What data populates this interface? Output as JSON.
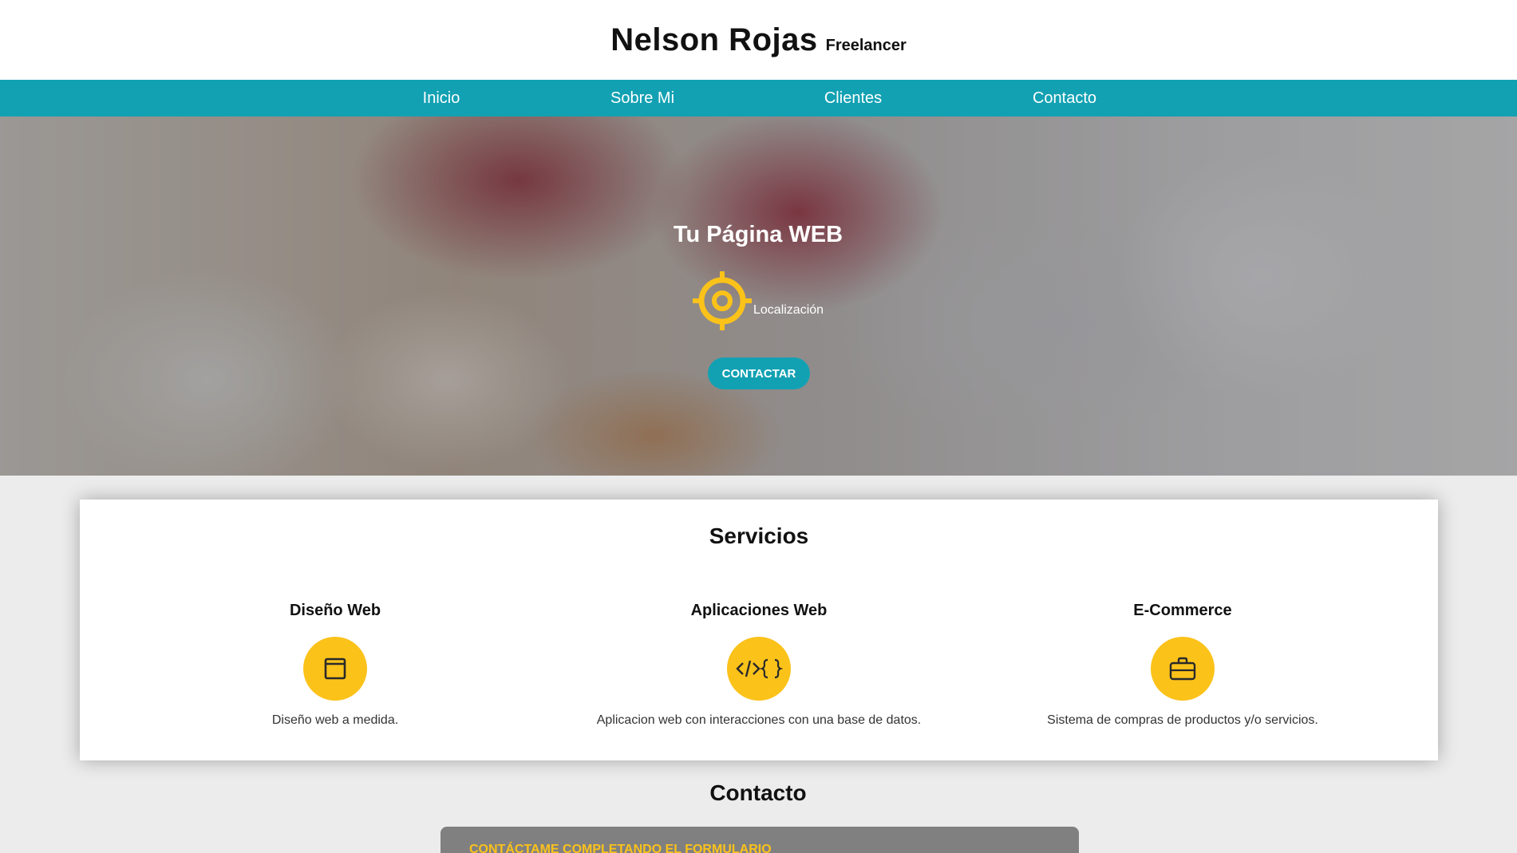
{
  "header": {
    "name": "Nelson Rojas",
    "tagline": "Freelancer"
  },
  "nav": {
    "items": [
      "Inicio",
      "Sobre Mi",
      "Clientes",
      "Contacto"
    ]
  },
  "hero": {
    "title": "Tu Página WEB",
    "location_icon": "target-icon",
    "location_label": "Localización",
    "cta_label": "CONTACTAR"
  },
  "services": {
    "title": "Servicios",
    "items": [
      {
        "title": "Diseño Web",
        "icon": "browser-window-icon",
        "description": "Diseño web a medida."
      },
      {
        "title": "Aplicaciones Web",
        "icon": "code-icon",
        "description": "Aplicacion web con interacciones con una base de datos."
      },
      {
        "title": "E-Commerce",
        "icon": "briefcase-icon",
        "description": "Sistema de compras de productos y/o servicios."
      }
    ]
  },
  "contact": {
    "title": "Contacto",
    "form_heading": "CONTÁCTAME COMPLETANDO EL FORMULARIO"
  },
  "colors": {
    "primary_teal": "#12a1b3",
    "accent_yellow": "#fbc21a"
  }
}
